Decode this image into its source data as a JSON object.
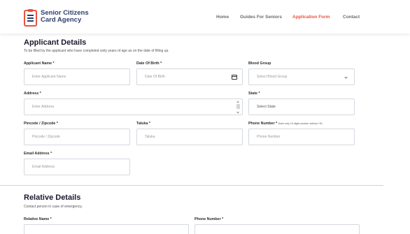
{
  "header": {
    "brand_line1": "Senior Citizens",
    "brand_line2": "Card Agency",
    "nav": [
      {
        "label": "Home",
        "active": false
      },
      {
        "label": "Guides For Seniors",
        "active": false
      },
      {
        "label": "Application Form",
        "active": true
      },
      {
        "label": "Contact",
        "active": false
      }
    ]
  },
  "applicant": {
    "title": "Applicant Details",
    "subtitle": "To be filled by the applicant who have completed sixty years of age as on the date of filling up.",
    "fields": {
      "name": {
        "label": "Applicant Name *",
        "placeholder": "Enter Applicant Name"
      },
      "dob": {
        "label": "Date Of Birth *",
        "placeholder": "Date Of Birth"
      },
      "blood": {
        "label": "Blood Group",
        "placeholder": "Select Blood Group"
      },
      "address": {
        "label": "Address *",
        "placeholder": "Enter Address"
      },
      "state": {
        "label": "State *",
        "placeholder": "Select State"
      },
      "pincode": {
        "label": "Pincode / Zipcode *",
        "placeholder": "Pincode / Zipcode"
      },
      "taluka": {
        "label": "Taluka *",
        "placeholder": "Taluka"
      },
      "phone": {
        "label": "Phone Number *",
        "hint": "Enter only 10 digits number without +91.",
        "placeholder": "Phone Number"
      },
      "email": {
        "label": "Email Address *",
        "placeholder": "Email Address"
      }
    }
  },
  "relative": {
    "title": "Relative Details",
    "subtitle": "Contact person in case of emergency.",
    "fields": {
      "name": {
        "label": "Relative Name *"
      },
      "phone": {
        "label": "Phone Number *"
      }
    }
  },
  "colors": {
    "accent": "#e8523f",
    "brand": "#2c3e6b",
    "border": "#d4d8de"
  }
}
